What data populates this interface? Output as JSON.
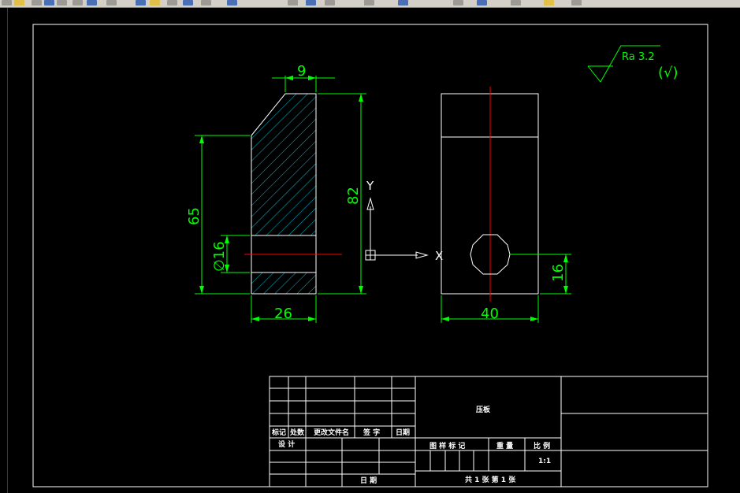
{
  "toolbar": {
    "icons": [
      "open-icon",
      "save-icon",
      "cut-icon",
      "copy-icon",
      "paste-icon",
      "undo-icon",
      "redo-icon",
      "pan-icon",
      "zoom-realtime-icon",
      "zoom-window-icon",
      "zoom-previous-icon",
      "properties-icon",
      "design-center-icon",
      "tool-palettes-icon",
      "sheet-set-icon",
      "markup-icon",
      "calculator-icon",
      "help-icon",
      "layer-icon",
      "layer-previous-icon",
      "color-icon"
    ]
  },
  "drawing": {
    "dims": {
      "width_top": "9",
      "height_total": "82",
      "height_65": "65",
      "hole_dia": "∅16",
      "width_26": "26",
      "width_40": "40",
      "hole_height": "16"
    },
    "roughness": {
      "symbol_text": "Ra 3.2",
      "general_mark": "(√)"
    },
    "ucs": {
      "x_label": "X",
      "y_label": "Y"
    }
  },
  "title_block": {
    "part_name": "压板",
    "headers": {
      "mark": "标记",
      "count": "处数",
      "change_doc": "更改文件名",
      "signature": "签 字",
      "date": "日期"
    },
    "design": "设 计",
    "date_bottom": "日 期",
    "stage_mark": "图 样 标 记",
    "weight": "重 量",
    "scale_label": "比 例",
    "scale_value": "1:1",
    "sheet": "共 1 张 第 1 张"
  }
}
